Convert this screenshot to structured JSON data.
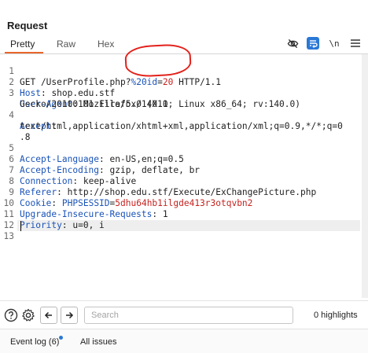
{
  "panel": {
    "title": "Request"
  },
  "tabs": [
    {
      "label": "Pretty",
      "active": true
    },
    {
      "label": "Raw",
      "active": false
    },
    {
      "label": "Hex",
      "active": false
    }
  ],
  "toolbar": {
    "icons": [
      "eye-slash-icon",
      "wrap-lines-icon",
      "newline-icon",
      "menu-icon"
    ],
    "newline_label": "\\n"
  },
  "request": {
    "line1": {
      "num": "1",
      "method_path": "GET /UserProfile.php",
      "query_sep": "?",
      "param_name": "%20id",
      "eq": "=",
      "param_value": "20",
      "proto": " HTTP/1.1"
    },
    "headers": [
      {
        "num": "2",
        "name": "Host",
        "value": " shop.edu.stf"
      },
      {
        "num": "3",
        "name": "User-Agent",
        "value": " Mozilla/5.0 (X11; Linux x86_64; rv:140.0)"
      },
      {
        "num": "",
        "name": "",
        "value": "Gecko/20100101 Firefox/140.0"
      },
      {
        "num": "4",
        "name": "Accept",
        "value": ""
      },
      {
        "num": "",
        "name": "",
        "value": "text/html,application/xhtml+xml,application/xml;q=0.9,*/*;q=0"
      },
      {
        "num": "",
        "name": "",
        "value": ".8"
      },
      {
        "num": "5",
        "name": "Accept-Language",
        "value": " en-US,en;q=0.5"
      },
      {
        "num": "6",
        "name": "Accept-Encoding",
        "value": " gzip, deflate, br"
      },
      {
        "num": "7",
        "name": "Connection",
        "value": " keep-alive"
      },
      {
        "num": "8",
        "name": "Referer",
        "value": " http://shop.edu.stf/Execute/ExChangePicture.php"
      }
    ],
    "cookie": {
      "num": "9",
      "name": "Cookie",
      "cookie_name": "PHPSESSID",
      "eq": "=",
      "cookie_value": "5dhu64hb1ilgde413r3otqvbn2"
    },
    "tail": [
      {
        "num": "10",
        "name": "Upgrade-Insecure-Requests",
        "value": " 1"
      },
      {
        "num": "11",
        "name": "Priority",
        "value": " u=0, i"
      },
      {
        "num": "12",
        "name": "",
        "value": ""
      },
      {
        "num": "13",
        "name": "",
        "value": ""
      }
    ]
  },
  "search": {
    "placeholder": "Search",
    "highlights": "0 highlights"
  },
  "status": {
    "event_log": "Event log (6)",
    "all_issues": "All issues"
  },
  "colors": {
    "accent": "#e8672c",
    "header_name": "#1a53b8",
    "value_red": "#c5221f",
    "annotation": "#e3211b",
    "notification": "#2a78d6"
  }
}
